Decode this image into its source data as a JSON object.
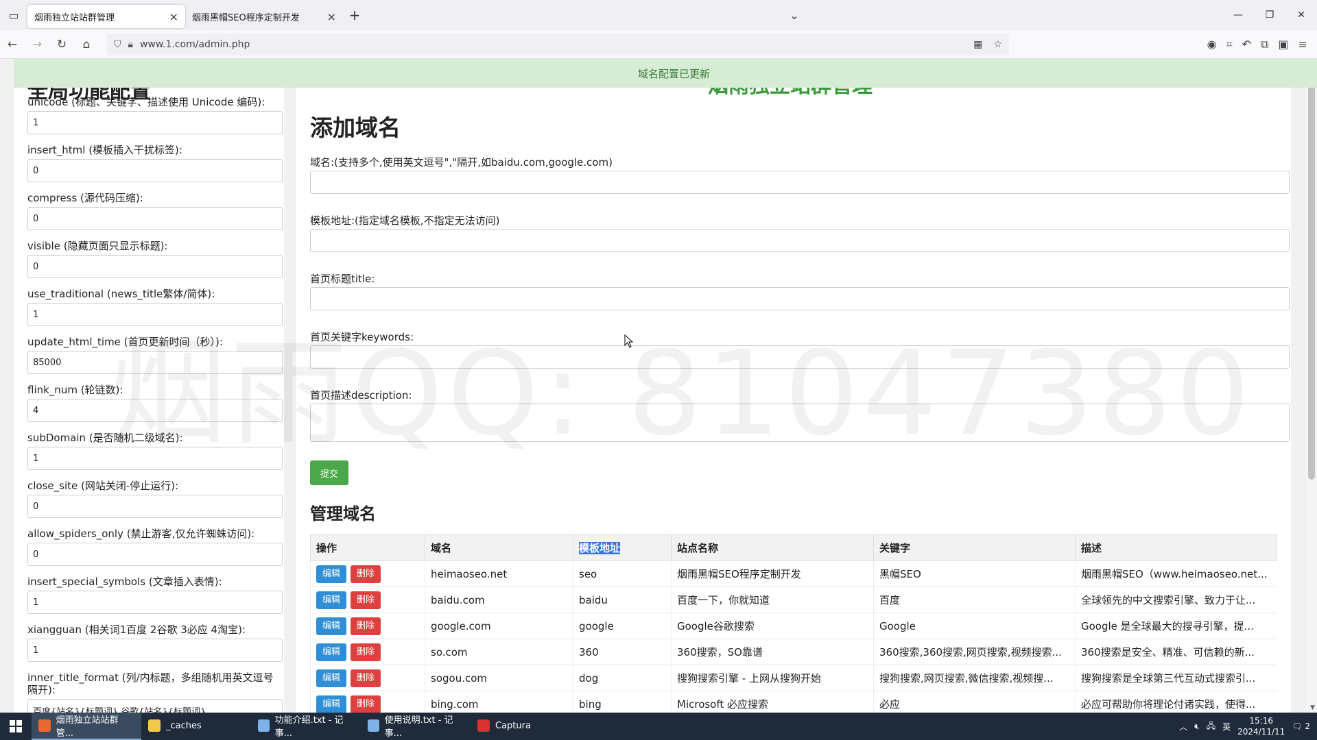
{
  "browser": {
    "tabs": [
      {
        "label": "烟雨独立站站群管理",
        "active": true
      },
      {
        "label": "烟雨黑帽SEO程序定制开发",
        "active": false
      }
    ],
    "url": "www.1.com/admin.php"
  },
  "notice": "域名配置已更新",
  "watermark": "烟雨QQ: 81047380",
  "left_panel": {
    "title_cut": "全局功能配置",
    "items": [
      {
        "label": "unicode (标题、关键字、描述使用 Unicode 编码):",
        "value": "1"
      },
      {
        "label": "insert_html (模板插入干扰标签):",
        "value": "0"
      },
      {
        "label": "compress (源代码压缩):",
        "value": "0"
      },
      {
        "label": "visible (隐藏页面只显示标题):",
        "value": "0"
      },
      {
        "label": "use_traditional (news_title繁体/简体):",
        "value": "1"
      },
      {
        "label": "update_html_time (首页更新时间（秒）):",
        "value": "85000"
      },
      {
        "label": "flink_num (轮链数):",
        "value": "4"
      },
      {
        "label": "subDomain (是否随机二级域名):",
        "value": "1"
      },
      {
        "label": "close_site (网站关闭-停止运行):",
        "value": "0"
      },
      {
        "label": "allow_spiders_only (禁止游客,仅允许蜘蛛访问):",
        "value": "0"
      },
      {
        "label": "insert_special_symbols (文章插入表情):",
        "value": "1"
      },
      {
        "label": "xiangguan (相关词1百度 2谷歌 3必应 4淘宝):",
        "value": "1"
      },
      {
        "label": "inner_title_format (列/内标题，多组随机用英文逗号隔开):",
        "value": "百度{站名}{标题词},谷歌{站名}{标题词}"
      }
    ]
  },
  "main_panel": {
    "title_cut": "烟雨独立站群管理",
    "add_heading": "添加域名",
    "fields": {
      "domain_label": "域名:(支持多个,使用英文逗号\",\"隔开,如baidu.com,google.com)",
      "template_label": "模板地址:(指定域名模板,不指定无法访问)",
      "title_label": "首页标题title:",
      "keywords_label": "首页关键字keywords:",
      "description_label": "首页描述description:"
    },
    "submit_label": "提交",
    "manage_heading": "管理域名",
    "table": {
      "headers": [
        "操作",
        "域名",
        "模板地址",
        "站点名称",
        "关键字",
        "描述"
      ],
      "edit_label": "编辑",
      "delete_label": "删除",
      "rows": [
        [
          "heimaoseo.net",
          "seo",
          "烟雨黑帽SEO程序定制开发",
          "黑帽SEO",
          "烟雨黑帽SEO（www.heimaoseo.net..."
        ],
        [
          "baidu.com",
          "baidu",
          "百度一下，你就知道",
          "百度",
          "全球领先的中文搜索引擎、致力于让..."
        ],
        [
          "google.com",
          "google",
          "Google谷歌搜索",
          "Google",
          "Google 是全球最大的搜寻引擎，提..."
        ],
        [
          "so.com",
          "360",
          "360搜索，SO靠谱",
          "360搜索,360搜索,网页搜索,视频搜索...",
          "360搜索是安全、精准、可信赖的新..."
        ],
        [
          "sogou.com",
          "dog",
          "搜狗搜索引擎 - 上网从搜狗开始",
          "搜狗搜索,网页搜索,微信搜索,视频搜...",
          "搜狗搜索是全球第三代互动式搜索引..."
        ],
        [
          "bing.com",
          "bing",
          "Microsoft 必应搜索",
          "必应",
          "必应可帮助你将理论付诸实践，使得..."
        ]
      ]
    }
  },
  "taskbar": {
    "items": [
      {
        "label": "烟雨独立站站群管...",
        "color": "#e8692f"
      },
      {
        "label": "_caches",
        "color": "#f2c94c"
      },
      {
        "label": "功能介绍.txt - 记事...",
        "color": "#7db3e8"
      },
      {
        "label": "使用说明.txt - 记事...",
        "color": "#7db3e8"
      },
      {
        "label": "Captura",
        "color": "#d93030"
      }
    ],
    "ime": "英",
    "time": "15:16",
    "date": "2024/11/11",
    "notif_count": "2"
  }
}
